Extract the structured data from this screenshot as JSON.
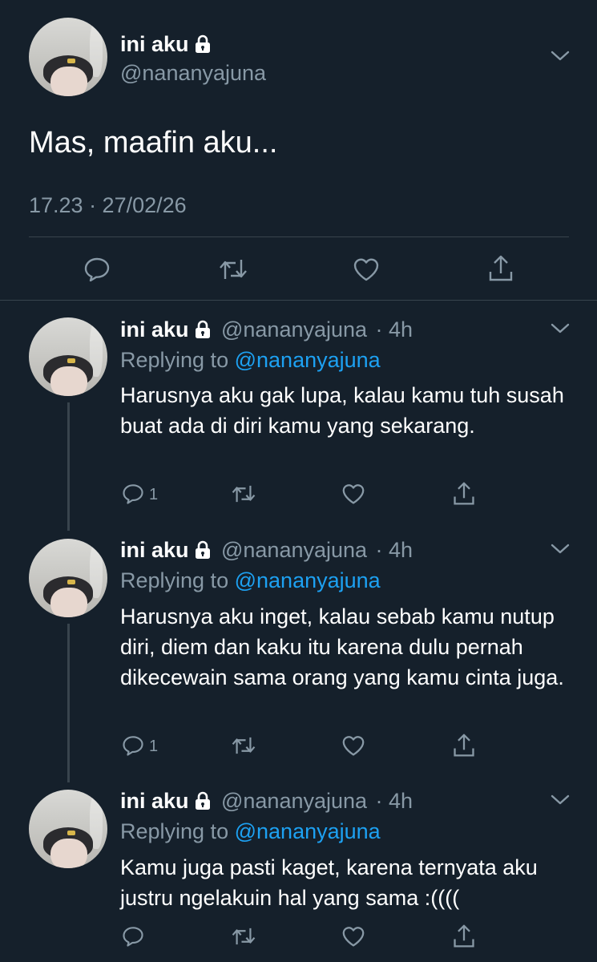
{
  "main_tweet": {
    "display_name": "ini aku",
    "handle": "@nananyajuna",
    "text": "Mas, maafin aku...",
    "timestamp": "17.23 · 27/02/26"
  },
  "replies": [
    {
      "display_name": "ini aku",
      "handle": "@nananyajuna",
      "time": "· 4h",
      "replying_label": "Replying to",
      "replying_to": "@nananyajuna",
      "text": "Harusnya aku gak lupa, kalau kamu tuh susah buat ada di diri kamu yang sekarang.",
      "reply_count": "1"
    },
    {
      "display_name": "ini aku",
      "handle": "@nananyajuna",
      "time": "· 4h",
      "replying_label": "Replying to",
      "replying_to": "@nananyajuna",
      "text": "Harusnya aku inget, kalau sebab kamu nutup diri, diem dan kaku itu karena dulu pernah dikecewain sama orang yang kamu cinta juga.",
      "reply_count": "1"
    },
    {
      "display_name": "ini aku",
      "handle": "@nananyajuna",
      "time": "· 4h",
      "replying_label": "Replying to",
      "replying_to": "@nananyajuna",
      "text": "Kamu juga pasti kaget, karena ternyata aku justru ngelakuin hal yang sama :((((",
      "reply_count": ""
    }
  ],
  "colors": {
    "background": "#15202b",
    "muted": "#8899a6",
    "link": "#1da1f2",
    "divider": "#38444d"
  },
  "icons": [
    "lock-icon",
    "chevron-down-icon",
    "reply-icon",
    "retweet-icon",
    "like-icon",
    "share-icon"
  ]
}
